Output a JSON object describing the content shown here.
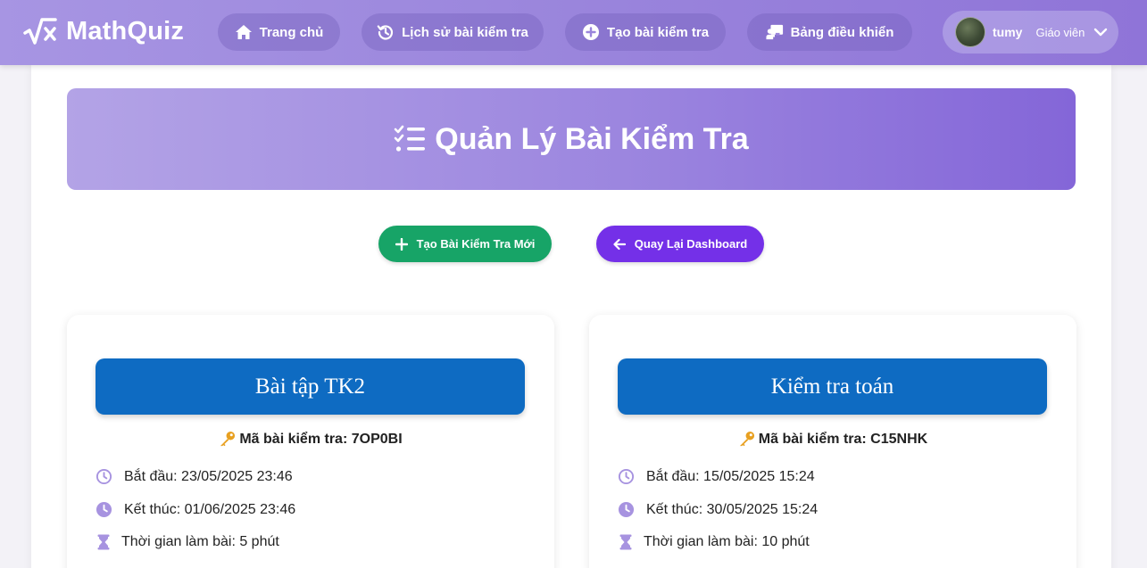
{
  "brand": {
    "name": "MathQuiz",
    "icon": "sqrt-x-icon"
  },
  "nav": {
    "home": {
      "label": "Trang chủ",
      "icon": "home-icon"
    },
    "history": {
      "label": "Lịch sử bài kiểm tra",
      "icon": "history-icon"
    },
    "create": {
      "label": "Tạo bài kiểm tra",
      "icon": "plus-circle-icon"
    },
    "dashboard": {
      "label": "Bảng điều khiển",
      "icon": "teacher-board-icon"
    }
  },
  "user": {
    "name": "tumy",
    "role": "Giáo viên"
  },
  "page": {
    "title": "Quản Lý Bài Kiểm Tra",
    "title_icon": "checklist-icon"
  },
  "actions": {
    "create_label": "Tạo Bài Kiểm Tra Mới",
    "back_label": "Quay Lại Dashboard"
  },
  "colors": {
    "green": "#17a467",
    "purple": "#7430e8",
    "card_title_bg": "#0e6bc2",
    "icon_accent": "#a793e0"
  },
  "quizzes": [
    {
      "title": "Bài tập TK2",
      "code": "Mã bài kiểm tra: 7OP0BI",
      "start": "Bắt đầu: 23/05/2025 23:46",
      "end": "Kết thúc: 01/06/2025 23:46",
      "duration": "Thời gian làm bài: 5 phút"
    },
    {
      "title": "Kiểm tra toán",
      "code": "Mã bài kiểm tra: C15NHK",
      "start": "Bắt đầu: 15/05/2025 15:24",
      "end": "Kết thúc: 30/05/2025 15:24",
      "duration": "Thời gian làm bài: 10 phút"
    }
  ]
}
